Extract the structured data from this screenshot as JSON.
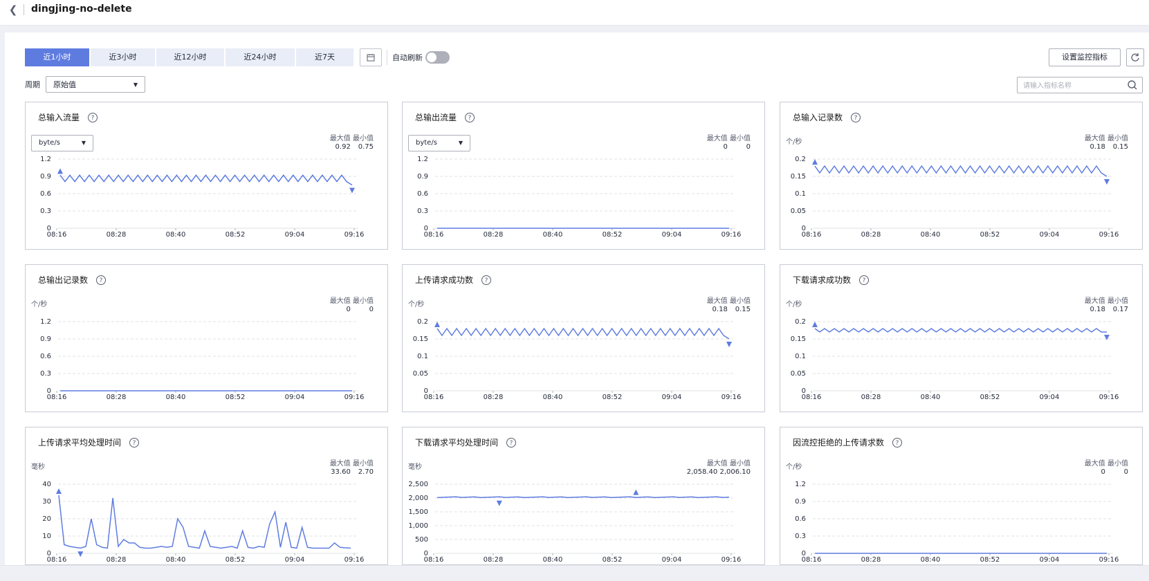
{
  "header": {
    "title": "dingjing-no-delete"
  },
  "toolbar": {
    "tabs": [
      {
        "label": "近1小时",
        "active": true
      },
      {
        "label": "近3小时",
        "active": false
      },
      {
        "label": "近12小时",
        "active": false
      },
      {
        "label": "近24小时",
        "active": false
      },
      {
        "label": "近7天",
        "active": false
      }
    ],
    "auto_refresh_label": "自动刷新",
    "auto_refresh_on": false,
    "set_metrics_label": "设置监控指标",
    "period_label": "周期",
    "period_value": "原始值",
    "search_placeholder": "请输入指标名称"
  },
  "colors": {
    "accent": "#5e7ce0",
    "line": "#5e7ce0",
    "grid": "#dfe1e6",
    "border": "#c7cbd3"
  },
  "max_label": "最大值",
  "min_label": "最小值",
  "time_ticks": [
    "08:16",
    "08:28",
    "08:40",
    "08:52",
    "09:04",
    "09:16"
  ],
  "chart_data": [
    {
      "type": "line",
      "title": "总输入流量",
      "unit": "byte/s",
      "unit_is_select": true,
      "max": "0.92",
      "min": "0.75",
      "y_ticks": [
        "0",
        "0.3",
        "0.6",
        "0.9",
        "1.2"
      ],
      "ylim": [
        0,
        1.2
      ],
      "x": [
        "08:16",
        "09:16"
      ],
      "series": [
        {
          "pattern": "zigzag",
          "low": 0.81,
          "high": 0.92,
          "end": 0.75,
          "max_marker": 0.92,
          "min_marker": 0.75
        }
      ]
    },
    {
      "type": "line",
      "title": "总输出流量",
      "unit": "byte/s",
      "unit_is_select": true,
      "max": "0",
      "min": "0",
      "y_ticks": [
        "0",
        "0.3",
        "0.6",
        "0.9",
        "1.2"
      ],
      "ylim": [
        0,
        1.2
      ],
      "series": [
        {
          "pattern": "flat",
          "value": 0
        }
      ]
    },
    {
      "type": "line",
      "title": "总输入记录数",
      "unit": "个/秒",
      "unit_is_select": false,
      "max": "0.18",
      "min": "0.15",
      "y_ticks": [
        "0",
        "0.05",
        "0.1",
        "0.15",
        "0.2"
      ],
      "ylim": [
        0,
        0.2
      ],
      "series": [
        {
          "pattern": "zigzag",
          "low": 0.16,
          "high": 0.18,
          "end": 0.15,
          "max_marker": 0.18,
          "min_marker": 0.15
        }
      ]
    },
    {
      "type": "line",
      "title": "总输出记录数",
      "unit": "个/秒",
      "unit_is_select": false,
      "max": "0",
      "min": "0",
      "y_ticks": [
        "0",
        "0.3",
        "0.6",
        "0.9",
        "1.2"
      ],
      "ylim": [
        0,
        1.2
      ],
      "series": [
        {
          "pattern": "flat",
          "value": 0
        }
      ]
    },
    {
      "type": "line",
      "title": "上传请求成功数",
      "unit": "个/秒",
      "unit_is_select": false,
      "max": "0.18",
      "min": "0.15",
      "y_ticks": [
        "0",
        "0.05",
        "0.1",
        "0.15",
        "0.2"
      ],
      "ylim": [
        0,
        0.2
      ],
      "series": [
        {
          "pattern": "zigzag",
          "low": 0.16,
          "high": 0.18,
          "end": 0.15,
          "max_marker": 0.18,
          "min_marker": 0.15
        }
      ]
    },
    {
      "type": "line",
      "title": "下载请求成功数",
      "unit": "个/秒",
      "unit_is_select": false,
      "max": "0.18",
      "min": "0.17",
      "y_ticks": [
        "0",
        "0.05",
        "0.1",
        "0.15",
        "0.2"
      ],
      "ylim": [
        0,
        0.2
      ],
      "series": [
        {
          "pattern": "zigzag",
          "low": 0.17,
          "high": 0.18,
          "end": 0.17,
          "max_marker": 0.18,
          "min_marker": 0.17
        }
      ]
    },
    {
      "type": "line",
      "title": "上传请求平均处理时间",
      "unit": "毫秒",
      "unit_is_select": false,
      "max": "33.60",
      "min": "2.70",
      "y_ticks": [
        "0",
        "10",
        "20",
        "30",
        "40"
      ],
      "ylim": [
        0,
        40
      ],
      "series": [
        {
          "pattern": "values",
          "max_marker": 33.6,
          "min_marker": 2.7,
          "values": [
            33.6,
            5,
            4,
            3.5,
            3,
            4,
            20,
            5,
            3.5,
            3,
            32,
            4,
            8,
            6,
            6,
            3.5,
            3,
            3,
            3.5,
            4,
            3.5,
            4,
            20,
            15,
            4,
            3.5,
            3,
            13,
            4,
            3.5,
            3,
            3.5,
            4,
            3,
            13,
            3.5,
            3,
            4,
            3.5,
            17,
            24,
            3.5,
            18,
            3.5,
            3,
            15,
            3.5,
            3,
            3,
            3,
            3,
            6,
            3.5,
            3.2,
            3
          ]
        }
      ]
    },
    {
      "type": "line",
      "title": "下载请求平均处理时间",
      "unit": "毫秒",
      "unit_is_select": false,
      "max": "2,058.40",
      "min": "2,006.10",
      "y_ticks": [
        "0",
        "500",
        "1,000",
        "1,500",
        "2,000",
        "2,500"
      ],
      "ylim": [
        0,
        2500
      ],
      "series": [
        {
          "pattern": "noisy",
          "value": 2030,
          "max_marker": 2058.4,
          "min_marker": 2006.1
        }
      ]
    },
    {
      "type": "line",
      "title": "因流控拒绝的上传请求数",
      "unit": "个/秒",
      "unit_is_select": false,
      "max": "0",
      "min": "0",
      "y_ticks": [
        "0",
        "0.3",
        "0.6",
        "0.9",
        "1.2"
      ],
      "ylim": [
        0,
        1.2
      ],
      "series": [
        {
          "pattern": "flat",
          "value": 0
        }
      ]
    }
  ]
}
